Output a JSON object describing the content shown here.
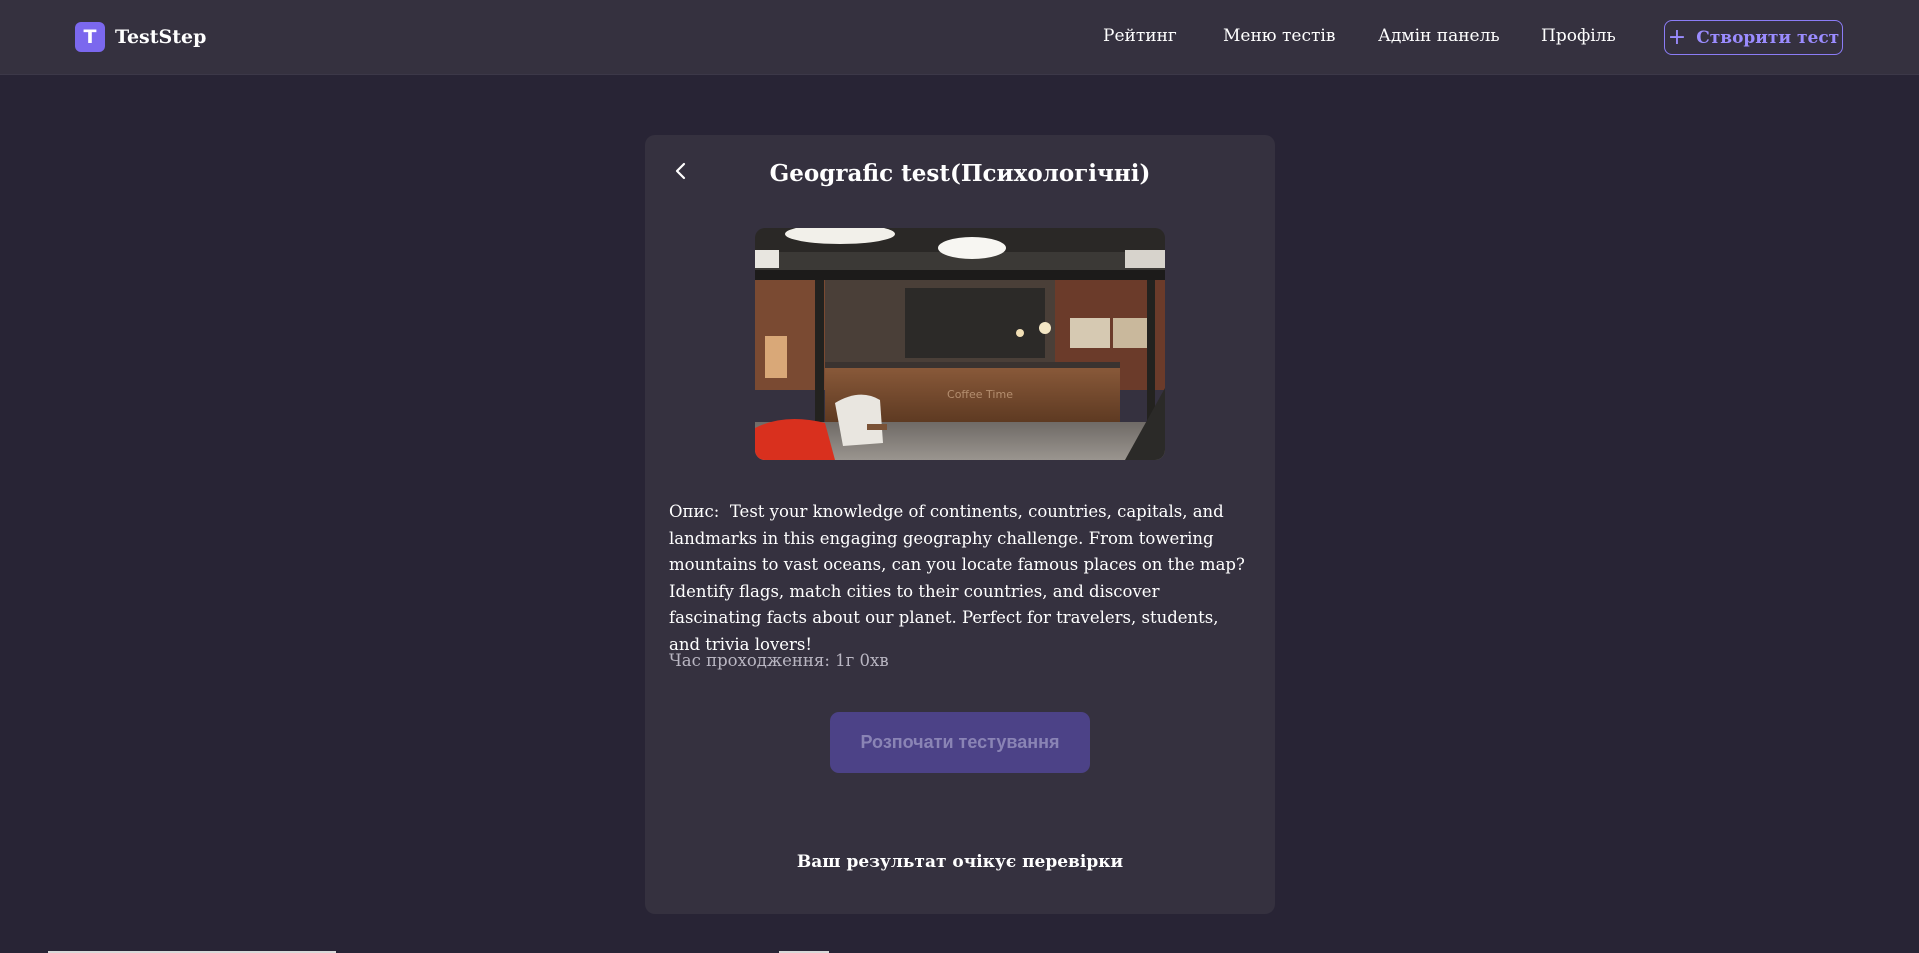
{
  "brand": {
    "logo_letter": "T",
    "name": "TestStep",
    "logo_color": "#7b68ee"
  },
  "nav": {
    "items": [
      {
        "label": "Рейтинг"
      },
      {
        "label": "Меню тестів"
      },
      {
        "label": "Адмін панель"
      },
      {
        "label": "Профіль"
      }
    ],
    "create_button": {
      "icon": "plus-icon",
      "label": "Створити тест",
      "color": "#8b7cf6"
    }
  },
  "test": {
    "back_icon": "chevron-left-icon",
    "title": "Geografic test(Психологічні)",
    "cover_sign_text": "Coffee  Time",
    "description_label": "Опис:",
    "description_text": "Test your knowledge of continents, countries, capitals, and landmarks in this engaging geography challenge. From towering mountains to vast oceans, can you locate famous places on the map? Identify flags, match cities to their countries, and discover fascinating facts about our planet. Perfect for travelers, students, and trivia lovers!",
    "time_label": "Час проходження:",
    "time_value": "1г 0хв",
    "start_button_label": "Розпочати тестування",
    "start_button_color": "#4c4287",
    "result_note": "Ваш результат очікує перевірки"
  },
  "colors": {
    "background": "#282435",
    "surface": "#35313f",
    "accent": "#8b7cf6"
  }
}
